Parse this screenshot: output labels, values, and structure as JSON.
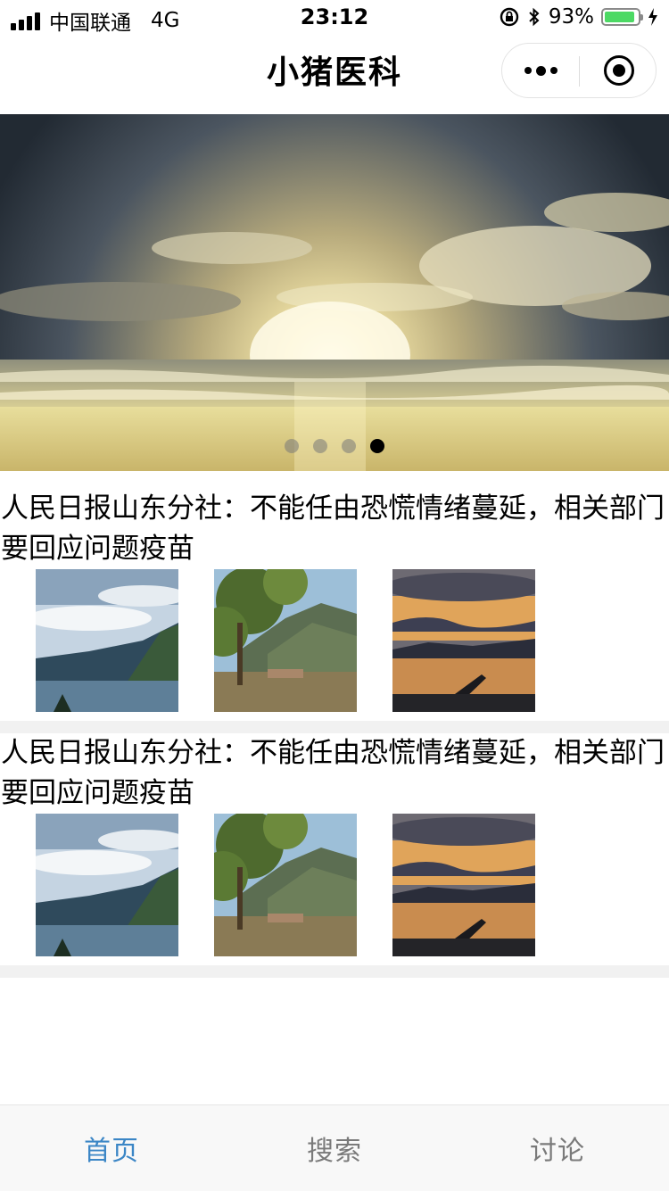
{
  "status_bar": {
    "carrier": "中国联通",
    "network": "4G",
    "time": "23:12",
    "battery_percent": "93%",
    "battery_level": 0.93
  },
  "nav": {
    "title": "小猪医科"
  },
  "banner": {
    "slide_count": 4,
    "active_index": 3
  },
  "news": [
    {
      "title": "人民日报山东分社：不能任由恐慌情绪蔓延，相关部门要回应问题疫苗",
      "images": [
        "lake-mountain-clouds",
        "tree-village-mountains",
        "sunset-lake"
      ]
    },
    {
      "title": "人民日报山东分社：不能任由恐慌情绪蔓延，相关部门要回应问题疫苗",
      "images": [
        "lake-mountain-clouds",
        "tree-village-mountains",
        "sunset-lake"
      ]
    }
  ],
  "tabbar": {
    "tabs": [
      {
        "label": "首页",
        "active": true
      },
      {
        "label": "搜索",
        "active": false
      },
      {
        "label": "讨论",
        "active": false
      }
    ],
    "active_color": "#3b86c6",
    "inactive_color": "#7a7a7a"
  }
}
